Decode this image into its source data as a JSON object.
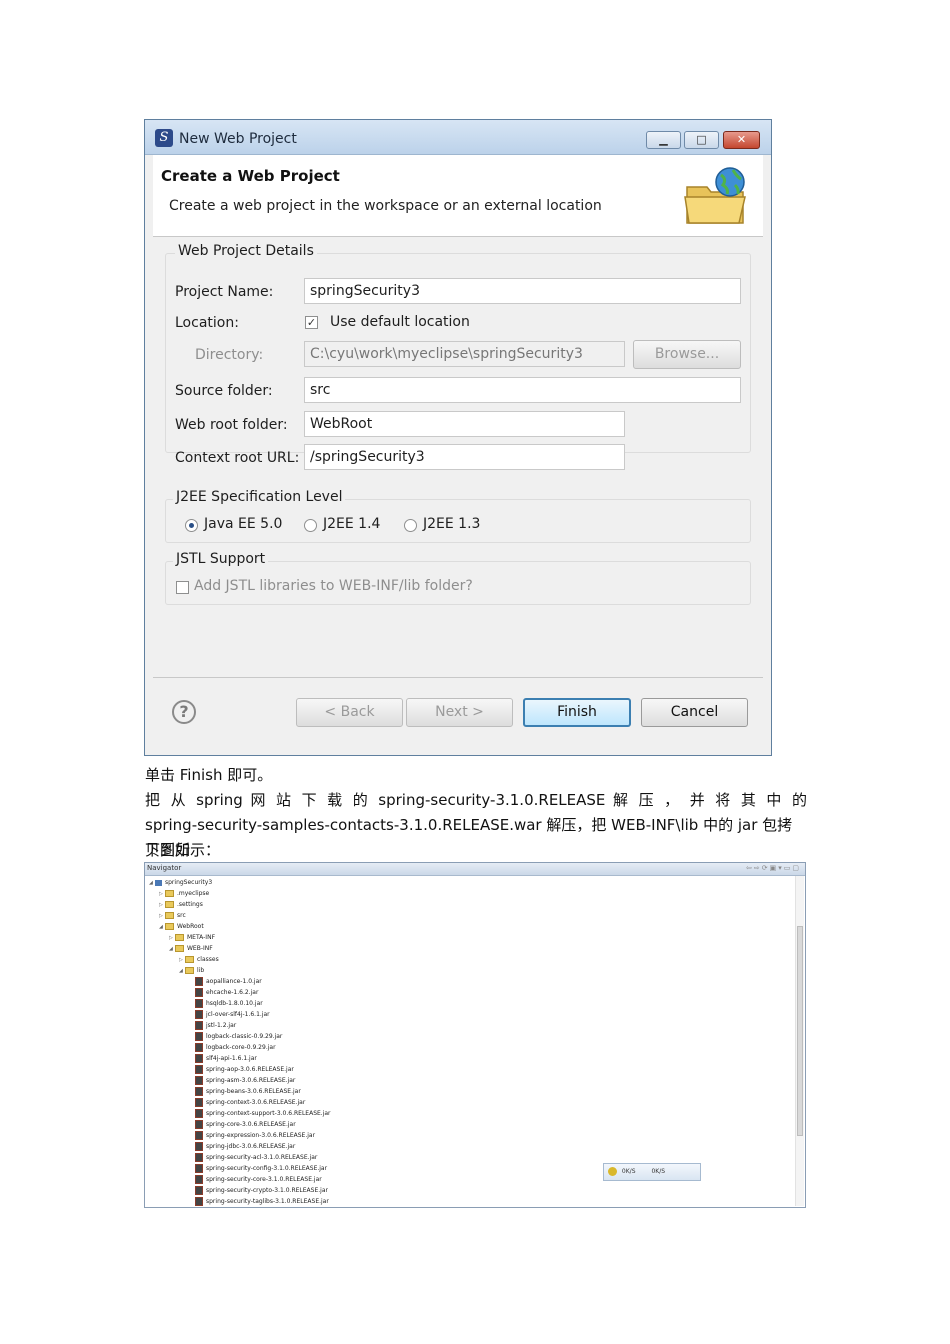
{
  "dialog": {
    "title": "New Web Project",
    "banner_title": "Create a Web Project",
    "banner_desc": "Create a web project in the workspace or an external location",
    "details": {
      "group_title": "Web Project Details",
      "project_name_label": "Project Name:",
      "project_name_value": "springSecurity3",
      "location_label": "Location:",
      "use_default_label": "Use default location",
      "use_default_checked": true,
      "directory_label": "Directory:",
      "directory_value": "C:\\cyu\\work\\myeclipse\\springSecurity3",
      "browse_label": "Browse...",
      "source_folder_label": "Source folder:",
      "source_folder_value": "src",
      "web_root_label": "Web root folder:",
      "web_root_value": "WebRoot",
      "context_root_label": "Context root URL:",
      "context_root_value": "/springSecurity3"
    },
    "j2ee": {
      "group_title": "J2EE Specification Level",
      "options": [
        "Java EE 5.0",
        "J2EE 1.4",
        "J2EE 1.3"
      ],
      "selected": "Java EE 5.0"
    },
    "jstl": {
      "group_title": "JSTL Support",
      "checkbox_label": "Add JSTL libraries to WEB-INF/lib folder?"
    },
    "buttons": {
      "back": "< Back",
      "next": "Next >",
      "finish": "Finish",
      "cancel": "Cancel"
    }
  },
  "text": {
    "line1": "单击 Finish 即可。",
    "line2": "把 从 spring 网 站 下 载 的 spring-security-3.1.0.RELEASE 解 压 ， 并 将 其 中 的",
    "line3": "spring-security-samples-contacts-3.1.0.RELEASE.war 解压，把 WEB-INF\\lib 中的 jar 包拷贝到如",
    "line4": "下图所示："
  },
  "navigator": {
    "tab_label": "Navigator",
    "tree": [
      {
        "label": "springSecurity3",
        "depth": 0,
        "kind": "project"
      },
      {
        "label": ".myeclipse",
        "depth": 1,
        "kind": "folder"
      },
      {
        "label": ".settings",
        "depth": 1,
        "kind": "folder"
      },
      {
        "label": "src",
        "depth": 1,
        "kind": "folder"
      },
      {
        "label": "WebRoot",
        "depth": 1,
        "kind": "folder"
      },
      {
        "label": "META-INF",
        "depth": 2,
        "kind": "folder"
      },
      {
        "label": "WEB-INF",
        "depth": 2,
        "kind": "folder"
      },
      {
        "label": "classes",
        "depth": 3,
        "kind": "folder"
      },
      {
        "label": "lib",
        "depth": 3,
        "kind": "folder"
      },
      {
        "label": "aopalliance-1.0.jar",
        "depth": 4,
        "kind": "jar"
      },
      {
        "label": "ehcache-1.6.2.jar",
        "depth": 4,
        "kind": "jar"
      },
      {
        "label": "hsqldb-1.8.0.10.jar",
        "depth": 4,
        "kind": "jar"
      },
      {
        "label": "jcl-over-slf4j-1.6.1.jar",
        "depth": 4,
        "kind": "jar"
      },
      {
        "label": "jstl-1.2.jar",
        "depth": 4,
        "kind": "jar"
      },
      {
        "label": "logback-classic-0.9.29.jar",
        "depth": 4,
        "kind": "jar"
      },
      {
        "label": "logback-core-0.9.29.jar",
        "depth": 4,
        "kind": "jar"
      },
      {
        "label": "slf4j-api-1.6.1.jar",
        "depth": 4,
        "kind": "jar"
      },
      {
        "label": "spring-aop-3.0.6.RELEASE.jar",
        "depth": 4,
        "kind": "jar"
      },
      {
        "label": "spring-asm-3.0.6.RELEASE.jar",
        "depth": 4,
        "kind": "jar"
      },
      {
        "label": "spring-beans-3.0.6.RELEASE.jar",
        "depth": 4,
        "kind": "jar"
      },
      {
        "label": "spring-context-3.0.6.RELEASE.jar",
        "depth": 4,
        "kind": "jar"
      },
      {
        "label": "spring-context-support-3.0.6.RELEASE.jar",
        "depth": 4,
        "kind": "jar"
      },
      {
        "label": "spring-core-3.0.6.RELEASE.jar",
        "depth": 4,
        "kind": "jar"
      },
      {
        "label": "spring-expression-3.0.6.RELEASE.jar",
        "depth": 4,
        "kind": "jar"
      },
      {
        "label": "spring-jdbc-3.0.6.RELEASE.jar",
        "depth": 4,
        "kind": "jar"
      },
      {
        "label": "spring-security-acl-3.1.0.RELEASE.jar",
        "depth": 4,
        "kind": "jar"
      },
      {
        "label": "spring-security-config-3.1.0.RELEASE.jar",
        "depth": 4,
        "kind": "jar"
      },
      {
        "label": "spring-security-core-3.1.0.RELEASE.jar",
        "depth": 4,
        "kind": "jar"
      },
      {
        "label": "spring-security-crypto-3.1.0.RELEASE.jar",
        "depth": 4,
        "kind": "jar"
      },
      {
        "label": "spring-security-taglibs-3.1.0.RELEASE.jar",
        "depth": 4,
        "kind": "jar"
      }
    ],
    "status_left": "0K/S",
    "status_right": "0K/S"
  }
}
